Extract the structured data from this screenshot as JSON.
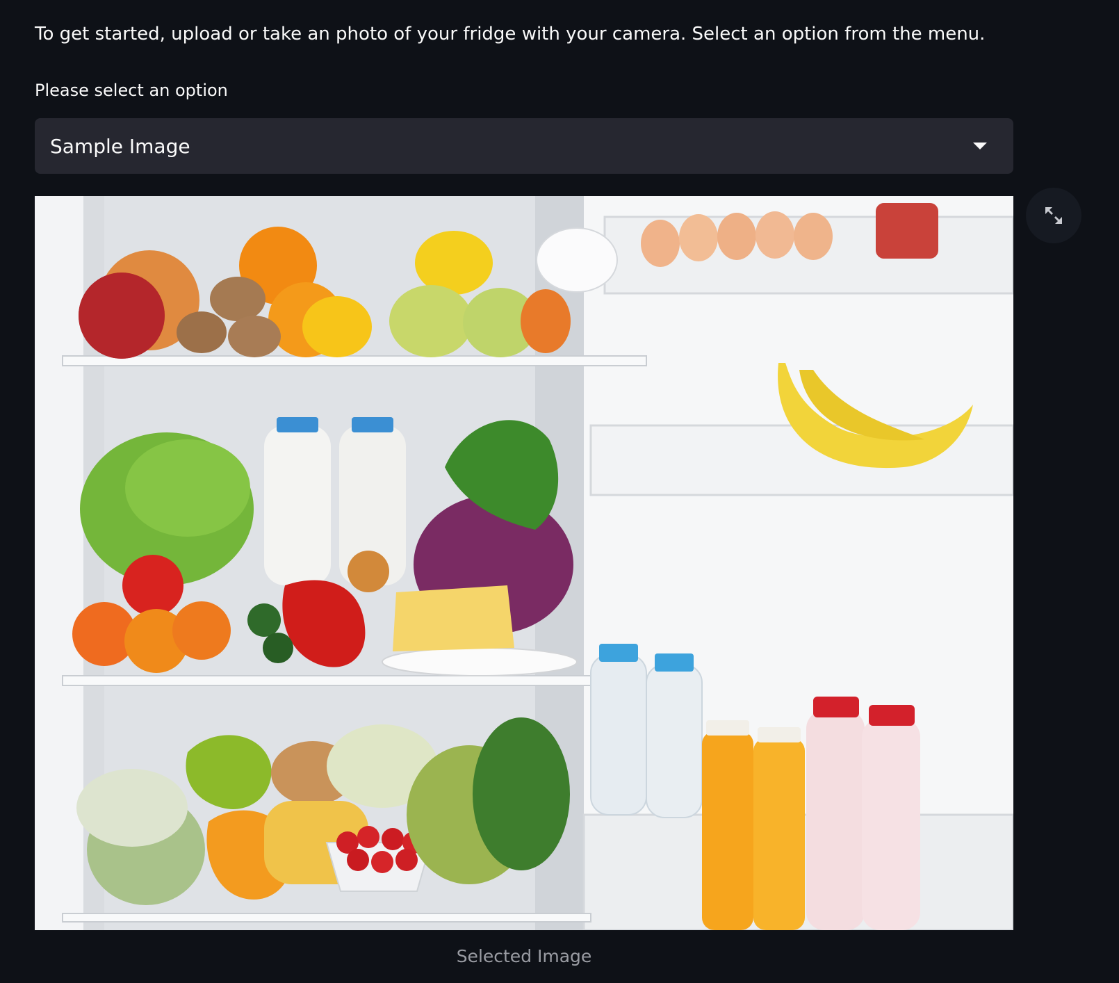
{
  "intro": {
    "text": "To get started, upload or take an photo of your fridge with your camera. Select an option from the menu."
  },
  "select": {
    "label": "Please select an option",
    "value": "Sample Image"
  },
  "image": {
    "caption": "Selected Image"
  },
  "icons": {
    "dropdown": "chevron-down-icon",
    "fullscreen": "fullscreen-icon"
  },
  "colors": {
    "background": "#0e1117",
    "select_background": "#262730",
    "caption": "#9a9ca3"
  }
}
